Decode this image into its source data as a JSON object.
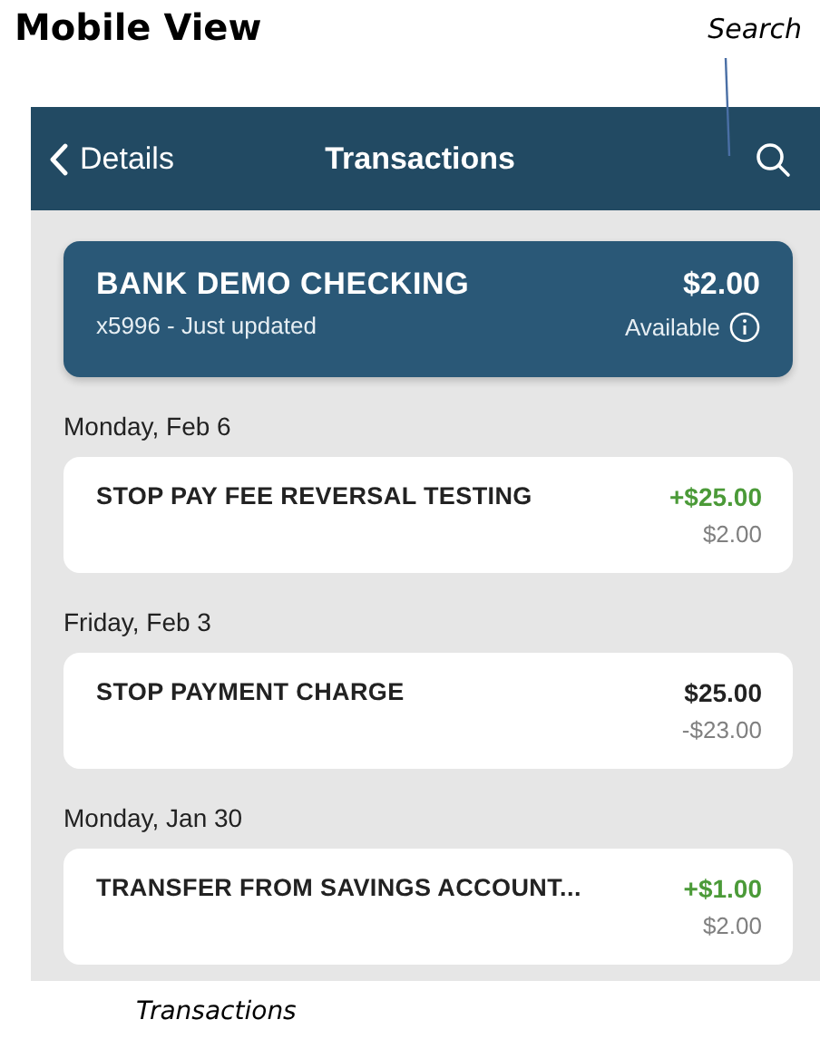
{
  "heading": "Mobile View",
  "callout": "Search",
  "nav": {
    "back": "Details",
    "title": "Transactions"
  },
  "account": {
    "name": "BANK DEMO CHECKING",
    "subtitle": "x5996 - Just updated",
    "balance": "$2.00",
    "balance_label": "Available"
  },
  "groups": [
    {
      "date": "Monday, Feb 6",
      "transactions": [
        {
          "description": "STOP PAY FEE REVERSAL TESTING",
          "amount": "+$25.00",
          "kind": "credit",
          "balance": "$2.00"
        }
      ]
    },
    {
      "date": "Friday, Feb 3",
      "transactions": [
        {
          "description": "STOP PAYMENT CHARGE",
          "amount": "$25.00",
          "kind": "debit",
          "balance": "-$23.00"
        }
      ]
    },
    {
      "date": "Monday, Jan 30",
      "transactions": [
        {
          "description": "TRANSFER FROM SAVINGS ACCOUNT...",
          "amount": "+$1.00",
          "kind": "credit",
          "balance": "$2.00"
        }
      ]
    }
  ],
  "caption": "Transactions"
}
